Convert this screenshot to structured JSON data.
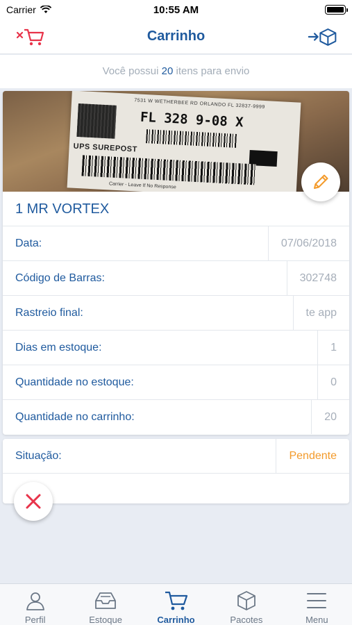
{
  "status_bar": {
    "carrier": "Carrier",
    "time": "10:55 AM"
  },
  "nav": {
    "title": "Carrinho",
    "left_icon": "clear-cart-icon",
    "right_icon": "send-package-icon"
  },
  "info": {
    "prefix": "Você possui",
    "count": "20",
    "suffix": "itens para envio"
  },
  "item": {
    "title": "1 MR VORTEX",
    "photo_text": {
      "route": "FL 328 9-08 X",
      "small": "7531 W WETHERBEE RD  ORLANDO FL 32837-9999",
      "service": "UPS SUREPOST",
      "note": "Carrier - Leave If No Response"
    },
    "fields": [
      {
        "label": "Data:",
        "value": "07/06/2018"
      },
      {
        "label": "Código de Barras:",
        "value": "302748"
      },
      {
        "label": "Rastreio final:",
        "value": "te app"
      },
      {
        "label": "Dias em estoque:",
        "value": "1"
      },
      {
        "label": "Quantidade no estoque:",
        "value": "0"
      },
      {
        "label": "Quantidade no carrinho:",
        "value": "20"
      }
    ]
  },
  "status": {
    "label": "Situação:",
    "value": "Pendente"
  },
  "tabs": [
    {
      "label": "Perfil",
      "icon": "person-icon",
      "active": false
    },
    {
      "label": "Estoque",
      "icon": "inbox-icon",
      "active": false
    },
    {
      "label": "Carrinho",
      "icon": "cart-icon",
      "active": true
    },
    {
      "label": "Pacotes",
      "icon": "box-icon",
      "active": false
    },
    {
      "label": "Menu",
      "icon": "menu-icon",
      "active": false
    }
  ],
  "colors": {
    "primary": "#1f5a9e",
    "accent_danger": "#e8334a",
    "pending": "#f39a2a",
    "edit": "#f39a2a"
  }
}
